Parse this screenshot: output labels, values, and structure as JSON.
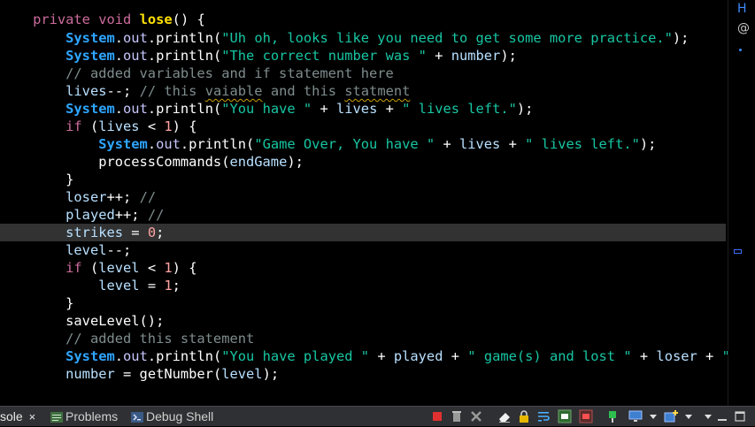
{
  "editor": {
    "code": {
      "l0": [
        "private",
        "void",
        "lose",
        "() {"
      ],
      "l1": [
        "System",
        ".",
        "out",
        ".println(",
        "\"Uh oh, looks like you need to get some more practice.\"",
        ");"
      ],
      "l2": [
        "System",
        ".",
        "out",
        ".println(",
        "\"The correct number was \"",
        " + ",
        "number",
        ");"
      ],
      "l3": [
        "// added variables and if statement here"
      ],
      "l4": [
        "lives",
        "--; ",
        "// this ",
        "vaiable",
        " and this ",
        "statment"
      ],
      "l5": [
        "System",
        ".",
        "out",
        ".println(",
        "\"You have \"",
        " + ",
        "lives",
        " + ",
        "\" lives left.\"",
        ");"
      ],
      "l6": [
        "if",
        " (",
        "lives",
        " < ",
        "1",
        ") {"
      ],
      "l7": [
        "System",
        ".",
        "out",
        ".println(",
        "\"Game Over, You have \"",
        " + ",
        "lives",
        " + ",
        "\" lives left.\"",
        ");"
      ],
      "l8": [
        "processCommands(",
        "endGame",
        ");"
      ],
      "l9": [
        "}"
      ],
      "l10": [
        "loser",
        "++; ",
        "//"
      ],
      "l11": [
        "played",
        "++; ",
        "//"
      ],
      "l12": [
        "strikes",
        " = ",
        "0",
        ";"
      ],
      "l13": [
        "level",
        "--;"
      ],
      "l14": [
        "if",
        " (",
        "level",
        " < ",
        "1",
        ") {"
      ],
      "l15": [
        "level",
        " = ",
        "1",
        ";"
      ],
      "l16": [
        "}"
      ],
      "l17": [
        "saveLevel();"
      ],
      "l18": [
        "// added this statement"
      ],
      "l19": [
        "System",
        ".",
        "out",
        ".println(",
        "\"You have played \"",
        " + ",
        "played",
        " + ",
        "\" game(s) and lost \"",
        " + ",
        "loser",
        " + ",
        "\" g"
      ],
      "l20": [
        "number",
        " = getNumber(",
        "level",
        ");"
      ]
    }
  },
  "overview_ruler": {
    "letter": "H",
    "symbol": "@"
  },
  "bottom_panel": {
    "tabs": [
      {
        "label": "sole",
        "close": "×",
        "active": true
      },
      {
        "label": "Problems",
        "active": false
      },
      {
        "label": "Debug Shell",
        "active": false
      }
    ],
    "toolbar_icons": [
      "terminate-icon",
      "remove-launch-icon",
      "remove-all-terminated-icon",
      "clear-console-icon",
      "scroll-lock-icon",
      "word-wrap-icon",
      "show-on-stdout-icon",
      "show-on-stderr-icon",
      "pin-console-icon",
      "display-console-icon",
      "open-console-icon",
      "view-menu-icon",
      "minimize-icon",
      "maximize-icon"
    ]
  },
  "colors": {
    "keyword": "#cc6c9c",
    "method_decl": "#ffe000",
    "class": "#2ea6ff",
    "string": "#17c6a3",
    "comment": "#7f8c8d",
    "number": "#ffa3a3",
    "current_line": "#323232",
    "panel_bg": "#2f3033"
  }
}
